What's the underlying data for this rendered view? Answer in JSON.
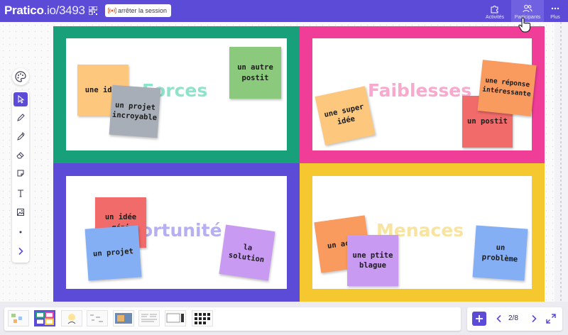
{
  "header": {
    "brand_name": "Pratico",
    "brand_code": ".io/3493",
    "stop_session_label": "arrêter la session",
    "nav": [
      {
        "label": "Activités",
        "icon": "puzzle-icon"
      },
      {
        "label": "Participants",
        "icon": "users-icon"
      },
      {
        "label": "Plus",
        "icon": "more-icon"
      }
    ]
  },
  "board": {
    "quadrants": [
      {
        "title": "Forces",
        "color": "#18a07a",
        "title_color": "#8ee3cc"
      },
      {
        "title": "Faiblesses",
        "color": "#f03d97",
        "title_color": "#f8a9cd"
      },
      {
        "title": "ortunité",
        "color": "#5b4bd6",
        "title_color": "#b7b0f0"
      },
      {
        "title": "Menaces",
        "color": "#f5c830",
        "title_color": "#f8e3a0"
      }
    ],
    "notes": [
      {
        "text": "une idée",
        "color": "#fdc77d"
      },
      {
        "text": "un projet incroyable",
        "color": "#a7aeb7"
      },
      {
        "text": "un autre postit",
        "color": "#8bc97c"
      },
      {
        "text": "une super idée",
        "color": "#fdc77d"
      },
      {
        "text": "un postit",
        "color": "#f26b6b"
      },
      {
        "text": "une réponse intéressante",
        "color": "#f99a5f"
      },
      {
        "text": "un idée géni",
        "color": "#f26b6b"
      },
      {
        "text": "un projet",
        "color": "#84aff5"
      },
      {
        "text": "la solution",
        "color": "#c99af2"
      },
      {
        "text": "un actu",
        "color": "#f99a5f"
      },
      {
        "text": "une ptite blague",
        "color": "#c99af2"
      },
      {
        "text": "un problème",
        "color": "#84aff5"
      }
    ]
  },
  "toolbar": {
    "tools": [
      "palette-icon",
      "select-icon",
      "pencil-icon",
      "marker-icon",
      "eraser-icon",
      "sticky-note-icon",
      "text-icon",
      "image-icon",
      "dot-icon",
      "expand-icon"
    ]
  },
  "footer": {
    "page_indicator": "2/8"
  },
  "colors": {
    "accent": "#5b4bd6"
  }
}
